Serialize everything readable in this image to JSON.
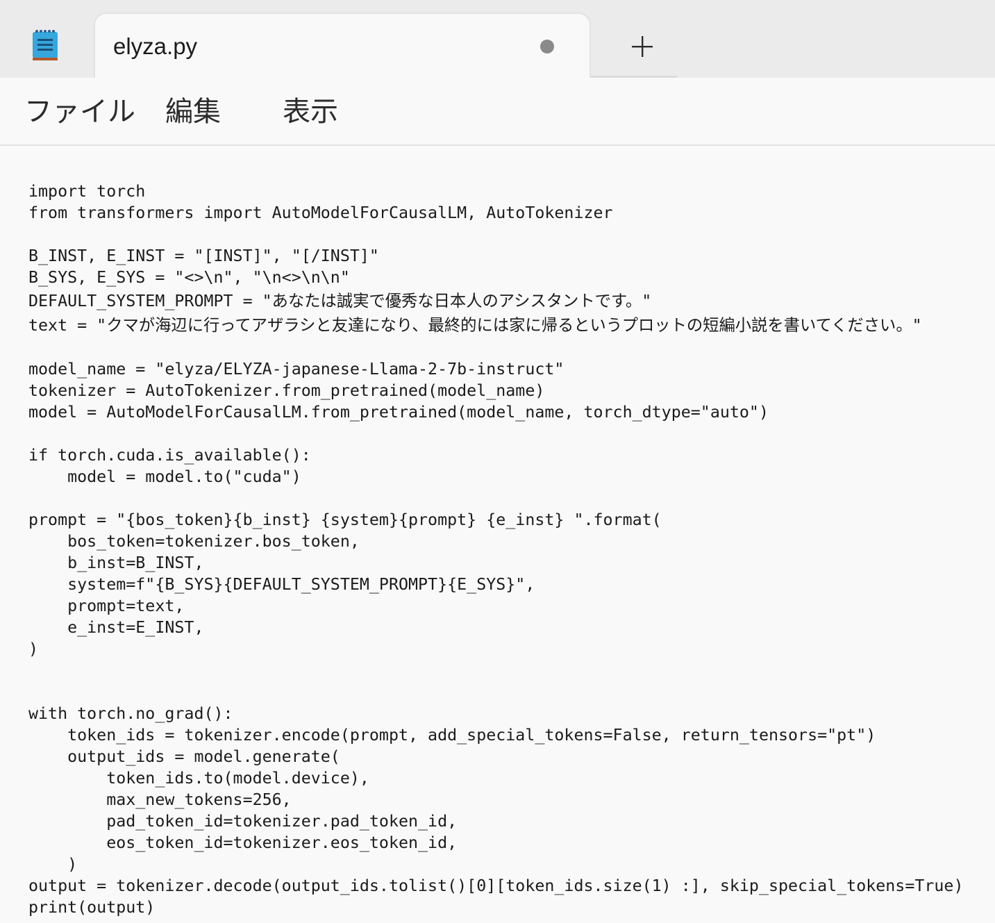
{
  "window": {
    "app_icon": "notepad-icon",
    "tab_title": "elyza.py",
    "unsaved_indicator": "unsaved-dot-icon",
    "new_tab_icon": "plus-icon"
  },
  "menu": {
    "items": [
      "ファイル",
      "編集",
      "表示"
    ]
  },
  "editor": {
    "lines": [
      "import torch",
      "from transformers import AutoModelForCausalLM, AutoTokenizer",
      "",
      "B_INST, E_INST = \"[INST]\", \"[/INST]\"",
      "B_SYS, E_SYS = \"<>\\n\", \"\\n<>\\n\\n\"",
      "DEFAULT_SYSTEM_PROMPT = \"あなたは誠実で優秀な日本人のアシスタントです。\"",
      "text = \"クマが海辺に行ってアザラシと友達になり、最終的には家に帰るというプロットの短編小説を書いてください。\"",
      "",
      "model_name = \"elyza/ELYZA-japanese-Llama-2-7b-instruct\"",
      "tokenizer = AutoTokenizer.from_pretrained(model_name)",
      "model = AutoModelForCausalLM.from_pretrained(model_name, torch_dtype=\"auto\")",
      "",
      "if torch.cuda.is_available():",
      "    model = model.to(\"cuda\")",
      "",
      "prompt = \"{bos_token}{b_inst} {system}{prompt} {e_inst} \".format(",
      "    bos_token=tokenizer.bos_token,",
      "    b_inst=B_INST,",
      "    system=f\"{B_SYS}{DEFAULT_SYSTEM_PROMPT}{E_SYS}\",",
      "    prompt=text,",
      "    e_inst=E_INST,",
      ")",
      "",
      "",
      "with torch.no_grad():",
      "    token_ids = tokenizer.encode(prompt, add_special_tokens=False, return_tensors=\"pt\")",
      "    output_ids = model.generate(",
      "        token_ids.to(model.device),",
      "        max_new_tokens=256,",
      "        pad_token_id=tokenizer.pad_token_id,",
      "        eos_token_id=tokenizer.eos_token_id,",
      "    )",
      "output = tokenizer.decode(output_ids.tolist()[0][token_ids.size(1) :], skip_special_tokens=True)",
      "print(output)"
    ]
  },
  "colors": {
    "titlebar_bg": "#ebebeb",
    "editor_bg": "#f9f9f9",
    "text": "#1b1b1b",
    "icon_blue": "#35a7dc",
    "icon_binding": "#b4582a"
  }
}
